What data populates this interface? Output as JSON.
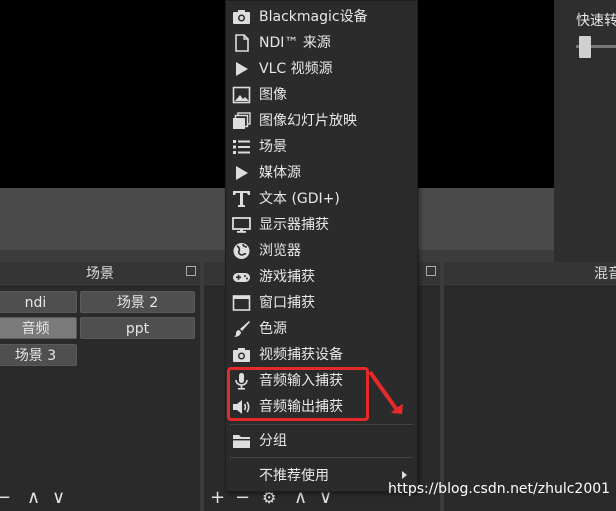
{
  "right_panel": {
    "title": "快速转"
  },
  "docks": {
    "scenes": {
      "title": "场景",
      "items": [
        "ndi",
        "场景 2",
        "音频",
        "ppt",
        "场景 3"
      ]
    },
    "mixer": {
      "title": "混音"
    },
    "toolbar": {
      "add": "+",
      "remove": "−",
      "up": "∧",
      "down": "∨"
    }
  },
  "menu": {
    "items": [
      {
        "label": "Blackmagic设备",
        "icon": "camera-icon"
      },
      {
        "label": "NDI™ 来源",
        "icon": "document-icon"
      },
      {
        "label": "VLC 视频源",
        "icon": "play-icon"
      },
      {
        "label": "图像",
        "icon": "image-icon"
      },
      {
        "label": "图像幻灯片放映",
        "icon": "slideshow-icon"
      },
      {
        "label": "场景",
        "icon": "list-icon"
      },
      {
        "label": "媒体源",
        "icon": "play-icon"
      },
      {
        "label": "文本 (GDI+)",
        "icon": "text-icon"
      },
      {
        "label": "显示器捕获",
        "icon": "monitor-icon"
      },
      {
        "label": "浏览器",
        "icon": "globe-icon"
      },
      {
        "label": "游戏捕获",
        "icon": "gamepad-icon"
      },
      {
        "label": "窗口捕获",
        "icon": "window-icon"
      },
      {
        "label": "色源",
        "icon": "brush-icon"
      },
      {
        "label": "视频捕获设备",
        "icon": "camera-icon"
      },
      {
        "label": "音频输入捕获",
        "icon": "microphone-icon"
      },
      {
        "label": "音频输出捕获",
        "icon": "speaker-icon"
      },
      {
        "label": "分组",
        "icon": "folder-icon"
      },
      {
        "label": "不推荐使用",
        "icon": "submenu-arrow-icon"
      }
    ]
  },
  "annotation": {
    "color": "#e42a2a"
  },
  "watermark": "https://blog.csdn.net/zhulc2001"
}
